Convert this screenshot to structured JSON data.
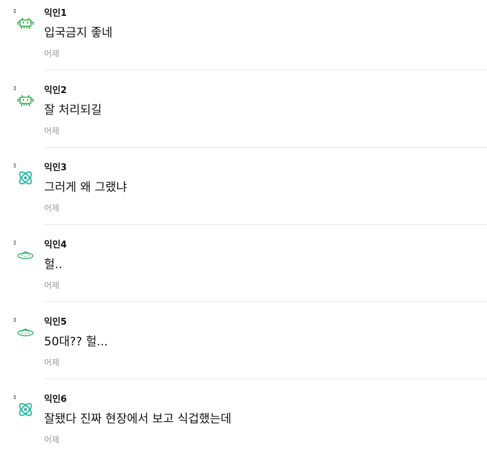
{
  "comments": [
    {
      "author": "익인1",
      "text": "입국금지 좋네",
      "time": "어제",
      "avatar_icon": "space-invader-icon",
      "avatar_color": "#2fb24a"
    },
    {
      "author": "익인2",
      "text": "잘 처리되길",
      "time": "어제",
      "avatar_icon": "space-invader-icon",
      "avatar_color": "#2fb24a"
    },
    {
      "author": "익인3",
      "text": "그러게 왜 그랬냐",
      "time": "어제",
      "avatar_icon": "atom-icon",
      "avatar_color": "#22b8a0"
    },
    {
      "author": "익인4",
      "text": "헐..",
      "time": "어제",
      "avatar_icon": "ufo-icon",
      "avatar_color": "#3cb371"
    },
    {
      "author": "익인5",
      "text": "50대?? 헐...",
      "time": "어제",
      "avatar_icon": "ufo-icon",
      "avatar_color": "#3cb371"
    },
    {
      "author": "익인6",
      "text": "잘됐다 진짜 현장에서 보고 식겁했는데",
      "time": "어제",
      "avatar_icon": "atom-icon",
      "avatar_color": "#22b8a0"
    }
  ]
}
